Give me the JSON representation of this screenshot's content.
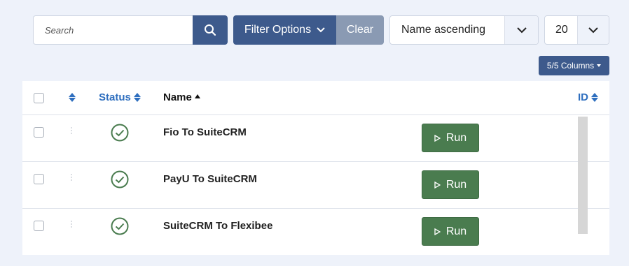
{
  "toolbar": {
    "search_placeholder": "Search",
    "search_icon": "search-icon",
    "filter_label": "Filter Options",
    "clear_label": "Clear",
    "sort_value": "Name ascending",
    "per_page_value": "20",
    "columns_label": "5/5 Columns"
  },
  "table": {
    "headers": {
      "status": "Status",
      "name": "Name",
      "id": "ID"
    },
    "rows": [
      {
        "name": "Fio To SuiteCRM",
        "status": "active",
        "action": "Run"
      },
      {
        "name": "PayU To SuiteCRM",
        "status": "active",
        "action": "Run"
      },
      {
        "name": "SuiteCRM To Flexibee",
        "status": "active",
        "action": "Run"
      }
    ]
  },
  "colors": {
    "primary": "#3d5a8c",
    "secondary": "#8a9ab3",
    "success": "#4a7c4f",
    "link": "#2f6fbf",
    "background": "#eef2fa"
  }
}
